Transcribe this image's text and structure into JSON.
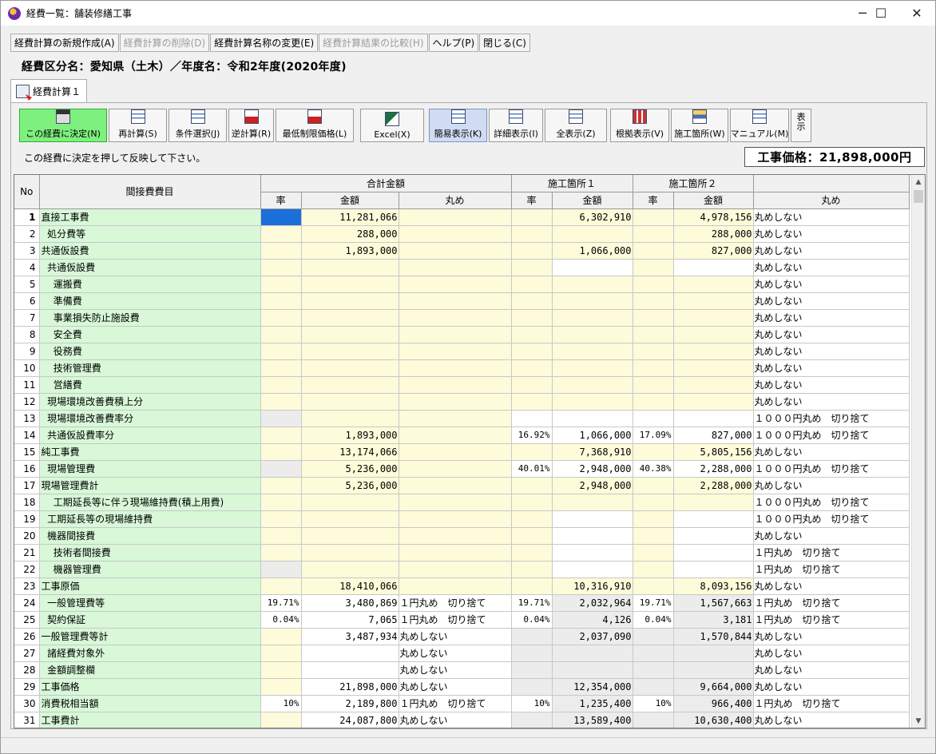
{
  "window": {
    "title": "経費一覧：舗装修繕工事",
    "minimize": "─",
    "maximize": "☐",
    "close": "✕"
  },
  "menu": [
    {
      "label": "経費計算の新規作成(A)",
      "enabled": true
    },
    {
      "label": "経費計算の削除(D)",
      "enabled": false
    },
    {
      "label": "経費計算名称の変更(E)",
      "enabled": true
    },
    {
      "label": "経費計算結果の比較(H)",
      "enabled": false
    },
    {
      "label": "ヘルプ(P)",
      "enabled": true
    },
    {
      "label": "閉じる(C)",
      "enabled": true
    }
  ],
  "header": "経費区分名：愛知県（土木）／年度名：令和2年度(2020年度)",
  "tab": {
    "label": "経費計算１"
  },
  "toolbar": [
    {
      "label": "この経費に決定(N)",
      "icon": "calculator-icon"
    },
    {
      "label": "再計算(S)",
      "icon": "recalc-icon"
    },
    {
      "label": "条件選択(J)",
      "icon": "condition-icon"
    },
    {
      "label": "逆計算(R)",
      "icon": "reverse-calc-icon"
    },
    {
      "label": "最低制限価格(L)",
      "icon": "min-price-icon"
    },
    {
      "label": "Excel(X)",
      "icon": "excel-icon"
    },
    {
      "label": "簡易表示(K)",
      "icon": "simple-view-icon"
    },
    {
      "label": "詳細表示(I)",
      "icon": "detail-view-icon"
    },
    {
      "label": "全表示(Z)",
      "icon": "all-view-icon"
    },
    {
      "label": "根拠表示(V)",
      "icon": "basis-view-icon"
    },
    {
      "label": "施工箇所(W)",
      "icon": "site-icon"
    },
    {
      "label": "マニュアル(M)",
      "icon": "manual-icon"
    }
  ],
  "toolbar_more": "表示",
  "hint": "この経費に決定を押して反映して下さい。",
  "price_label": "工事価格：21,898,000円",
  "grid": {
    "headers": {
      "no": "No",
      "item": "間接費費目",
      "total": "合計金額",
      "site1": "施工箇所１",
      "site2": "施工箇所２",
      "rate": "率",
      "amount": "金額",
      "rounding": "丸め"
    },
    "rows": [
      {
        "no": "1",
        "name": "直接工事費",
        "r": "",
        "amt": "11,281,066",
        "rnd": "",
        "r1": "",
        "a1": "6,302,910",
        "r2": "",
        "a2": "4,978,156",
        "rnd2": "丸めしない"
      },
      {
        "no": "2",
        "name": "  処分費等",
        "r": "",
        "amt": "288,000",
        "rnd": "",
        "r1": "",
        "a1": "",
        "r2": "",
        "a2": "288,000",
        "rnd2": "丸めしない"
      },
      {
        "no": "3",
        "name": "共通仮設費",
        "r": "",
        "amt": "1,893,000",
        "rnd": "",
        "r1": "",
        "a1": "1,066,000",
        "r2": "",
        "a2": "827,000",
        "rnd2": "丸めしない"
      },
      {
        "no": "4",
        "name": "  共通仮設費",
        "r": "",
        "amt": "",
        "rnd": "",
        "r1": "",
        "a1": "",
        "r2": "",
        "a2": "",
        "rnd2": "丸めしない"
      },
      {
        "no": "5",
        "name": "    運搬費",
        "r": "",
        "amt": "",
        "rnd": "",
        "r1": "",
        "a1": "",
        "r2": "",
        "a2": "",
        "rnd2": "丸めしない"
      },
      {
        "no": "6",
        "name": "    準備費",
        "r": "",
        "amt": "",
        "rnd": "",
        "r1": "",
        "a1": "",
        "r2": "",
        "a2": "",
        "rnd2": "丸めしない"
      },
      {
        "no": "7",
        "name": "    事業損失防止施設費",
        "r": "",
        "amt": "",
        "rnd": "",
        "r1": "",
        "a1": "",
        "r2": "",
        "a2": "",
        "rnd2": "丸めしない"
      },
      {
        "no": "8",
        "name": "    安全費",
        "r": "",
        "amt": "",
        "rnd": "",
        "r1": "",
        "a1": "",
        "r2": "",
        "a2": "",
        "rnd2": "丸めしない"
      },
      {
        "no": "9",
        "name": "    役務費",
        "r": "",
        "amt": "",
        "rnd": "",
        "r1": "",
        "a1": "",
        "r2": "",
        "a2": "",
        "rnd2": "丸めしない"
      },
      {
        "no": "10",
        "name": "    技術管理費",
        "r": "",
        "amt": "",
        "rnd": "",
        "r1": "",
        "a1": "",
        "r2": "",
        "a2": "",
        "rnd2": "丸めしない"
      },
      {
        "no": "11",
        "name": "    営繕費",
        "r": "",
        "amt": "",
        "rnd": "",
        "r1": "",
        "a1": "",
        "r2": "",
        "a2": "",
        "rnd2": "丸めしない"
      },
      {
        "no": "12",
        "name": "  現場環境改善費積上分",
        "r": "",
        "amt": "",
        "rnd": "",
        "r1": "",
        "a1": "",
        "r2": "",
        "a2": "",
        "rnd2": "丸めしない"
      },
      {
        "no": "13",
        "name": "  現場環境改善費率分",
        "r": "",
        "amt": "",
        "rnd": "",
        "r1": "",
        "a1": "",
        "r2": "",
        "a2": "",
        "rnd2": "１０００円丸め　切り捨て"
      },
      {
        "no": "14",
        "name": "  共通仮設費率分",
        "r": "",
        "amt": "1,893,000",
        "rnd": "",
        "r1": "16.92%",
        "a1": "1,066,000",
        "r2": "17.09%",
        "a2": "827,000",
        "rnd2": "１０００円丸め　切り捨て"
      },
      {
        "no": "15",
        "name": "純工事費",
        "r": "",
        "amt": "13,174,066",
        "rnd": "",
        "r1": "",
        "a1": "7,368,910",
        "r2": "",
        "a2": "5,805,156",
        "rnd2": "丸めしない"
      },
      {
        "no": "16",
        "name": "  現場管理費",
        "r": "",
        "amt": "5,236,000",
        "rnd": "",
        "r1": "40.01%",
        "a1": "2,948,000",
        "r2": "40.38%",
        "a2": "2,288,000",
        "rnd2": "１０００円丸め　切り捨て"
      },
      {
        "no": "17",
        "name": "現場管理費計",
        "r": "",
        "amt": "5,236,000",
        "rnd": "",
        "r1": "",
        "a1": "2,948,000",
        "r2": "",
        "a2": "2,288,000",
        "rnd2": "丸めしない"
      },
      {
        "no": "18",
        "name": "    工期延長等に伴う現場維持費(積上用費)",
        "r": "",
        "amt": "",
        "rnd": "",
        "r1": "",
        "a1": "",
        "r2": "",
        "a2": "",
        "rnd2": "１０００円丸め　切り捨て"
      },
      {
        "no": "19",
        "name": "  工期延長等の現場維持費",
        "r": "",
        "amt": "",
        "rnd": "",
        "r1": "",
        "a1": "",
        "r2": "",
        "a2": "",
        "rnd2": "１０００円丸め　切り捨て"
      },
      {
        "no": "20",
        "name": "  機器間接費",
        "r": "",
        "amt": "",
        "rnd": "",
        "r1": "",
        "a1": "",
        "r2": "",
        "a2": "",
        "rnd2": "丸めしない"
      },
      {
        "no": "21",
        "name": "    技術者間接費",
        "r": "",
        "amt": "",
        "rnd": "",
        "r1": "",
        "a1": "",
        "r2": "",
        "a2": "",
        "rnd2": "１円丸め　切り捨て"
      },
      {
        "no": "22",
        "name": "    機器管理費",
        "r": "",
        "amt": "",
        "rnd": "",
        "r1": "",
        "a1": "",
        "r2": "",
        "a2": "",
        "rnd2": "１円丸め　切り捨て"
      },
      {
        "no": "23",
        "name": "工事原価",
        "r": "",
        "amt": "18,410,066",
        "rnd": "",
        "r1": "",
        "a1": "10,316,910",
        "r2": "",
        "a2": "8,093,156",
        "rnd2": "丸めしない"
      },
      {
        "no": "24",
        "name": "  一般管理費等",
        "r": "19.71%",
        "amt": "3,480,869",
        "rnd": "１円丸め　切り捨て",
        "r1": "19.71%",
        "a1": "2,032,964",
        "r2": "19.71%",
        "a2": "1,567,663",
        "rnd2": "１円丸め　切り捨て"
      },
      {
        "no": "25",
        "name": "  契約保証",
        "r": "0.04%",
        "amt": "7,065",
        "rnd": "１円丸め　切り捨て",
        "r1": "0.04%",
        "a1": "4,126",
        "r2": "0.04%",
        "a2": "3,181",
        "rnd2": "１円丸め　切り捨て"
      },
      {
        "no": "26",
        "name": "一般管理費等計",
        "r": "",
        "amt": "3,487,934",
        "rnd": "丸めしない",
        "r1": "",
        "a1": "2,037,090",
        "r2": "",
        "a2": "1,570,844",
        "rnd2": "丸めしない"
      },
      {
        "no": "27",
        "name": "  諸経費対象外",
        "r": "",
        "amt": "",
        "rnd": "丸めしない",
        "r1": "",
        "a1": "",
        "r2": "",
        "a2": "",
        "rnd2": "丸めしない"
      },
      {
        "no": "28",
        "name": "  金額調整欄",
        "r": "",
        "amt": "",
        "rnd": "丸めしない",
        "r1": "",
        "a1": "",
        "r2": "",
        "a2": "",
        "rnd2": "丸めしない"
      },
      {
        "no": "29",
        "name": "工事価格",
        "r": "",
        "amt": "21,898,000",
        "rnd": "丸めしない",
        "r1": "",
        "a1": "12,354,000",
        "r2": "",
        "a2": "9,664,000",
        "rnd2": "丸めしない"
      },
      {
        "no": "30",
        "name": "消費税相当額",
        "r": "10%",
        "amt": "2,189,800",
        "rnd": "１円丸め　切り捨て",
        "r1": "10%",
        "a1": "1,235,400",
        "r2": "10%",
        "a2": "966,400",
        "rnd2": "１円丸め　切り捨て"
      },
      {
        "no": "31",
        "name": "工事費計",
        "r": "",
        "amt": "24,087,800",
        "rnd": "丸めしない",
        "r1": "",
        "a1": "13,589,400",
        "r2": "",
        "a2": "10,630,400",
        "rnd2": "丸めしない"
      }
    ]
  },
  "colors": {
    "name_bg": "#d8f8d8",
    "input_bg": "#fdfbd9",
    "disabled_bg": "#ececec",
    "selected": "#1a6fd8",
    "decide_button": "#7ef07e"
  }
}
